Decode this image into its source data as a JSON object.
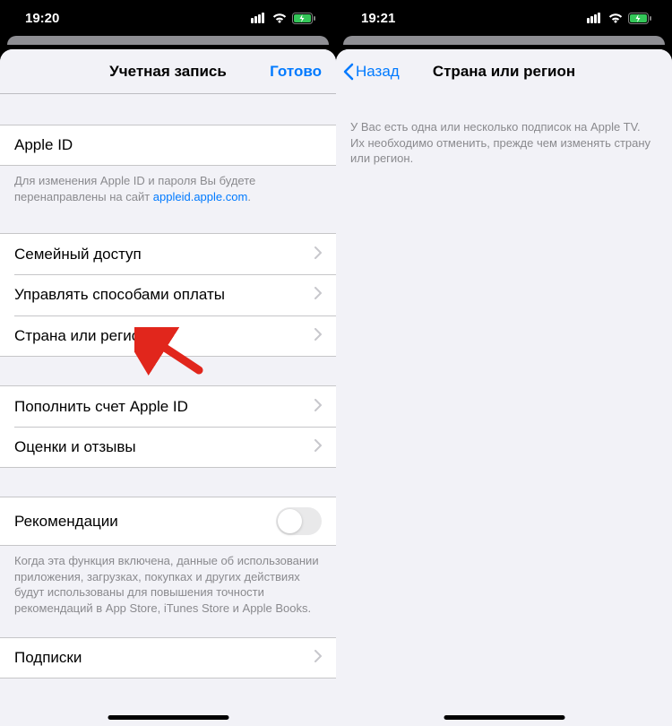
{
  "left": {
    "status": {
      "time": "19:20"
    },
    "nav": {
      "title": "Учетная запись",
      "done": "Готово"
    },
    "rows": {
      "apple_id": "Apple ID",
      "apple_id_footer_pre": "Для изменения Apple ID и пароля Вы будете перенаправлены на сайт ",
      "apple_id_footer_link": "appleid.apple.com",
      "apple_id_footer_post": ".",
      "family": "Семейный доступ",
      "payments": "Управлять способами оплаты",
      "country": "Страна или регион",
      "fund": "Пополнить счет Apple ID",
      "reviews": "Оценки и отзывы",
      "recs": "Рекомендации",
      "recs_footer": "Когда эта функция включена, данные об использовании приложения, загрузках, покупках и других действиях будут использованы для повышения точности рекомендаций в App Store, iTunes Store и Apple Books.",
      "subs": "Подписки"
    }
  },
  "right": {
    "status": {
      "time": "19:21"
    },
    "nav": {
      "back": "Назад",
      "title": "Страна или регион"
    },
    "info": "У Вас есть одна или несколько подписок на Apple TV. Их необходимо отменить, прежде чем изменять страну или регион."
  }
}
